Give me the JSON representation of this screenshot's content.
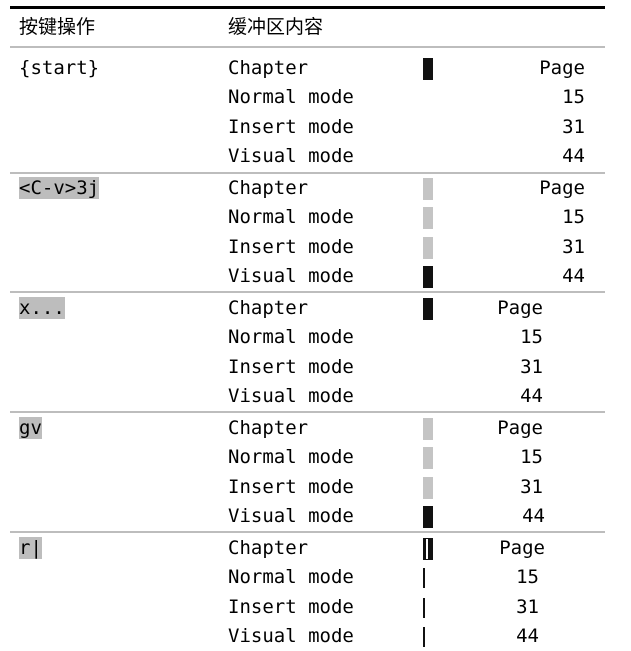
{
  "header": {
    "col_keys": "按键操作",
    "col_buffer": "缓冲区内容"
  },
  "rows": [
    {
      "key": "{start}",
      "lines": [
        "Chapter",
        "Normal mode",
        "Insert mode",
        "Visual mode"
      ],
      "values": [
        "Page",
        "15",
        "31",
        "44"
      ]
    },
    {
      "key": "<C-v>3j",
      "lines": [
        "Chapter",
        "Normal mode",
        "Insert mode",
        "Visual mode"
      ],
      "values": [
        "Page",
        "15",
        "31",
        "44"
      ]
    },
    {
      "key": "x...",
      "lines": [
        "Chapter",
        "Normal mode",
        "Insert mode",
        "Visual mode"
      ],
      "values": [
        "Page",
        "15",
        "31",
        "44"
      ]
    },
    {
      "key": "gv",
      "lines": [
        "Chapter",
        "Normal mode",
        "Insert mode",
        "Visual mode"
      ],
      "values": [
        "Page",
        "15",
        "31",
        "44"
      ]
    },
    {
      "key": "r|",
      "lines": [
        "Chapter",
        "Normal mode",
        "Insert mode",
        "Visual mode"
      ],
      "values": [
        "Page",
        "15",
        "31",
        "44"
      ]
    }
  ]
}
